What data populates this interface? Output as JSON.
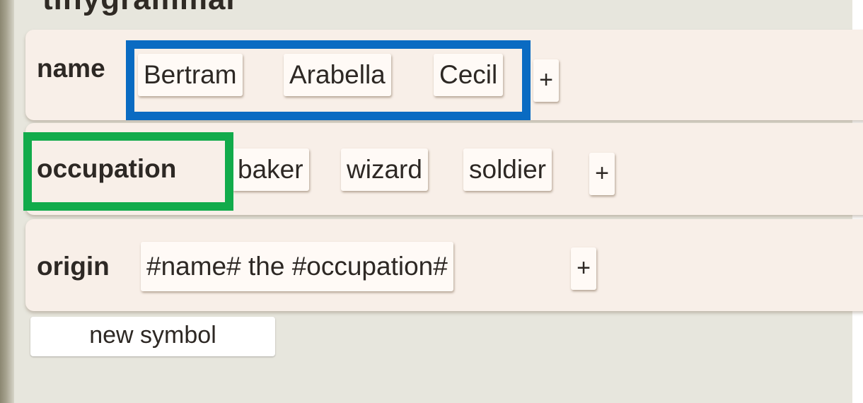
{
  "app": {
    "title": "tinygrammar"
  },
  "rules": [
    {
      "symbol": "name",
      "expansions": [
        "Bertram",
        "Arabella",
        "Cecil"
      ],
      "add_label": "+"
    },
    {
      "symbol": "occupation",
      "expansions": [
        "baker",
        "wizard",
        "soldier"
      ],
      "add_label": "+"
    },
    {
      "symbol": "origin",
      "expansions": [
        "#name# the #occupation#"
      ],
      "add_label": "+"
    }
  ],
  "new_symbol_label": "new symbol",
  "highlights": {
    "name_expansions_color": "#0a6bc2",
    "occupation_label_color": "#12ab4b"
  }
}
